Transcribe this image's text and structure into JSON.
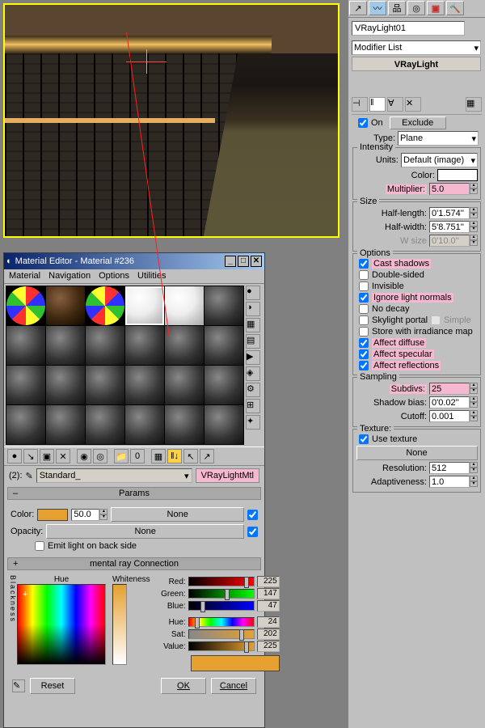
{
  "viewport": {
    "object_name": "VRayLight01"
  },
  "modifier_panel": {
    "name_field": "VRayLight01",
    "modifier_list_label": "Modifier List",
    "stack_item": "VRayLight",
    "general": {
      "on_label": "On",
      "on": true,
      "exclude_btn": "Exclude",
      "type_label": "Type:",
      "type_value": "Plane"
    },
    "intensity": {
      "title": "Intensity",
      "units_label": "Units:",
      "units_value": "Default (image)",
      "color_label": "Color:",
      "multiplier_label": "Multiplier:",
      "multiplier_value": "5.0"
    },
    "size": {
      "title": "Size",
      "half_length_label": "Half-length:",
      "half_length_value": "0'1.574''",
      "half_width_label": "Half-width:",
      "half_width_value": "5'8.751''",
      "w_size_label": "W size",
      "w_size_value": "0'10.0''"
    },
    "options": {
      "title": "Options",
      "cast_shadows": "Cast shadows",
      "double_sided": "Double-sided",
      "invisible": "Invisible",
      "ignore_normals": "Ignore light normals",
      "no_decay": "No decay",
      "skylight_portal": "Skylight portal",
      "simple": "Simple",
      "store_irr": "Store with irradiance map",
      "affect_diffuse": "Affect diffuse",
      "affect_specular": "Affect specular",
      "affect_reflections": "Affect reflections"
    },
    "sampling": {
      "title": "Sampling",
      "subdivs_label": "Subdivs:",
      "subdivs_value": "25",
      "shadow_bias_label": "Shadow bias:",
      "shadow_bias_value": "0'0.02''",
      "cutoff_label": "Cutoff:",
      "cutoff_value": "0.001"
    },
    "texture": {
      "title": "Texture:",
      "use_texture": "Use texture",
      "none_btn": "None",
      "resolution_label": "Resolution:",
      "resolution_value": "512",
      "adaptiveness_label": "Adaptiveness:",
      "adaptiveness_value": "1.0"
    }
  },
  "material_editor": {
    "title": "Material Editor - Material #236",
    "menu": {
      "material": "Material",
      "navigation": "Navigation",
      "options": "Options",
      "utilities": "Utilities"
    },
    "slot_label": "(2):",
    "type_dropdown": "Standard_",
    "type_button": "VRayLightMtl",
    "rollouts": {
      "params": "Params",
      "mental_ray": "mental ray Connection"
    },
    "params": {
      "color_label": "Color:",
      "color_value": "50.0",
      "none1": "None",
      "opacity_label": "Opacity:",
      "none2": "None",
      "emit_back": "Emit light on back side"
    },
    "color_picker": {
      "hue_label": "Hue",
      "whiteness_label": "Whiteness",
      "blackness_label": "Blackness",
      "red_label": "Red:",
      "red_value": "225",
      "green_label": "Green:",
      "green_value": "147",
      "blue_label": "Blue:",
      "blue_value": "47",
      "hue2_label": "Hue:",
      "hue_value": "24",
      "sat_label": "Sat:",
      "sat_value": "202",
      "value_label": "Value:",
      "value_value": "225",
      "reset_btn": "Reset",
      "ok_btn": "OK",
      "cancel_btn": "Cancel"
    }
  }
}
